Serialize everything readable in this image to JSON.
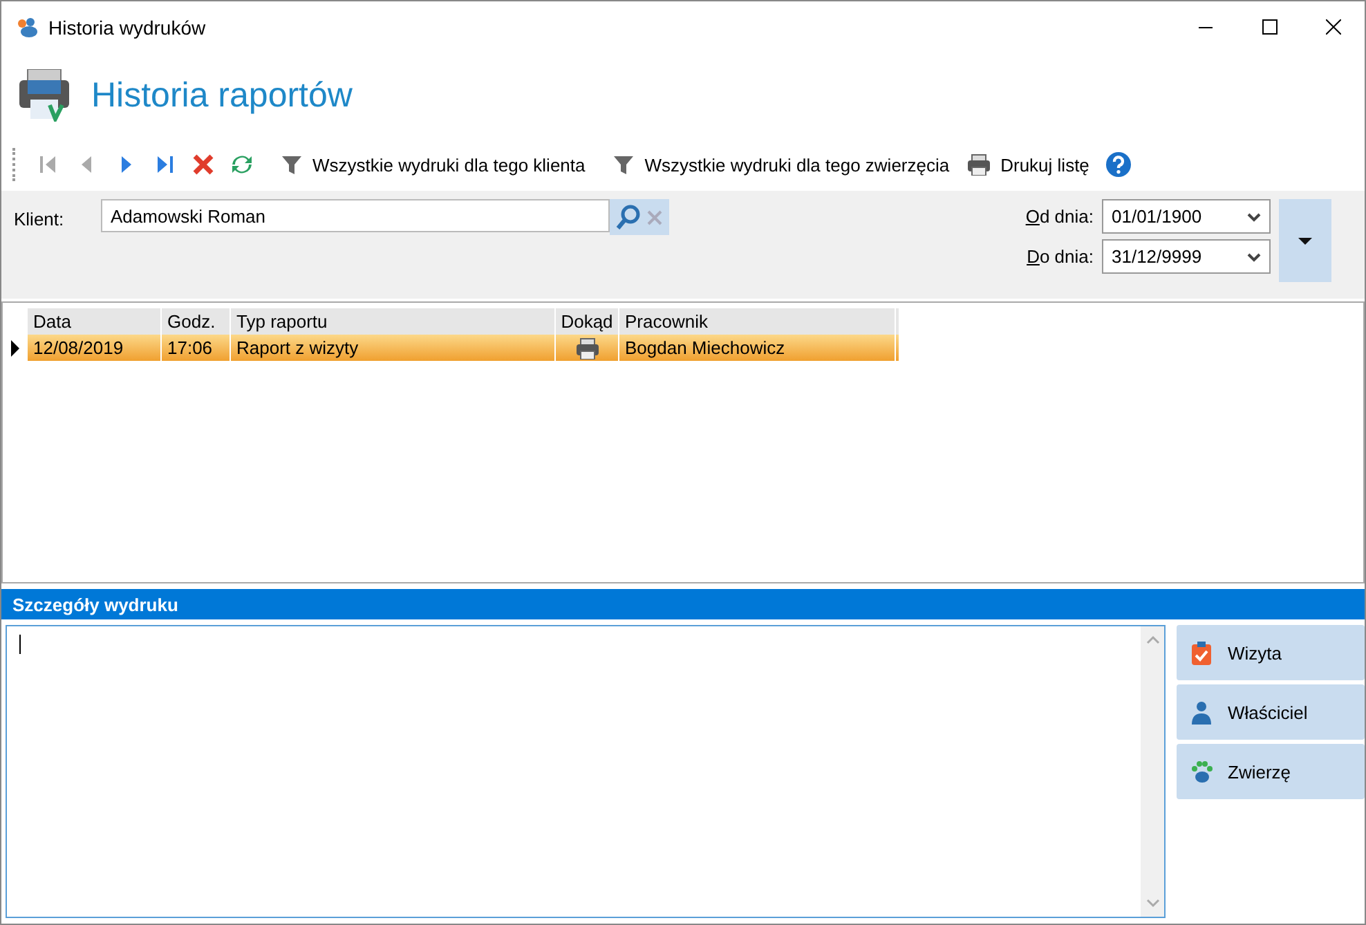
{
  "window": {
    "title": "Historia wydruków"
  },
  "header": {
    "title": "Historia raportów"
  },
  "toolbar": [
    {
      "kind": "first",
      "disabled": true
    },
    {
      "kind": "prev",
      "disabled": true
    },
    {
      "kind": "next",
      "disabled": false
    },
    {
      "kind": "last",
      "disabled": false
    },
    {
      "kind": "delete"
    },
    {
      "kind": "refresh"
    },
    {
      "kind": "filter",
      "label": "Wszystkie wydruki dla tego klienta"
    },
    {
      "kind": "filter",
      "label": "Wszystkie wydruki dla tego zwierzęcia"
    },
    {
      "kind": "print",
      "label": "Drukuj listę"
    },
    {
      "kind": "help"
    }
  ],
  "filter": {
    "client_label": "Klient:",
    "client_value": "Adamowski Roman",
    "from_label": "Od dnia:",
    "from_value": "01/01/1900",
    "to_label": "Do dnia:",
    "to_value": "31/12/9999"
  },
  "table": {
    "columns": [
      "Data",
      "Godz.",
      "Typ raportu",
      "Dokąd",
      "Pracownik"
    ],
    "rows": [
      {
        "date": "12/08/2019",
        "time": "17:06",
        "type": "Raport z wizyty",
        "employee": "Bogdan Miechowicz",
        "selected": true
      }
    ]
  },
  "details": {
    "title": "Szczegóły wydruku"
  },
  "side_buttons": [
    {
      "kind": "visit",
      "label": "Wizyta"
    },
    {
      "kind": "owner",
      "label": "Właściciel"
    },
    {
      "kind": "animal",
      "label": "Zwierzę"
    }
  ]
}
